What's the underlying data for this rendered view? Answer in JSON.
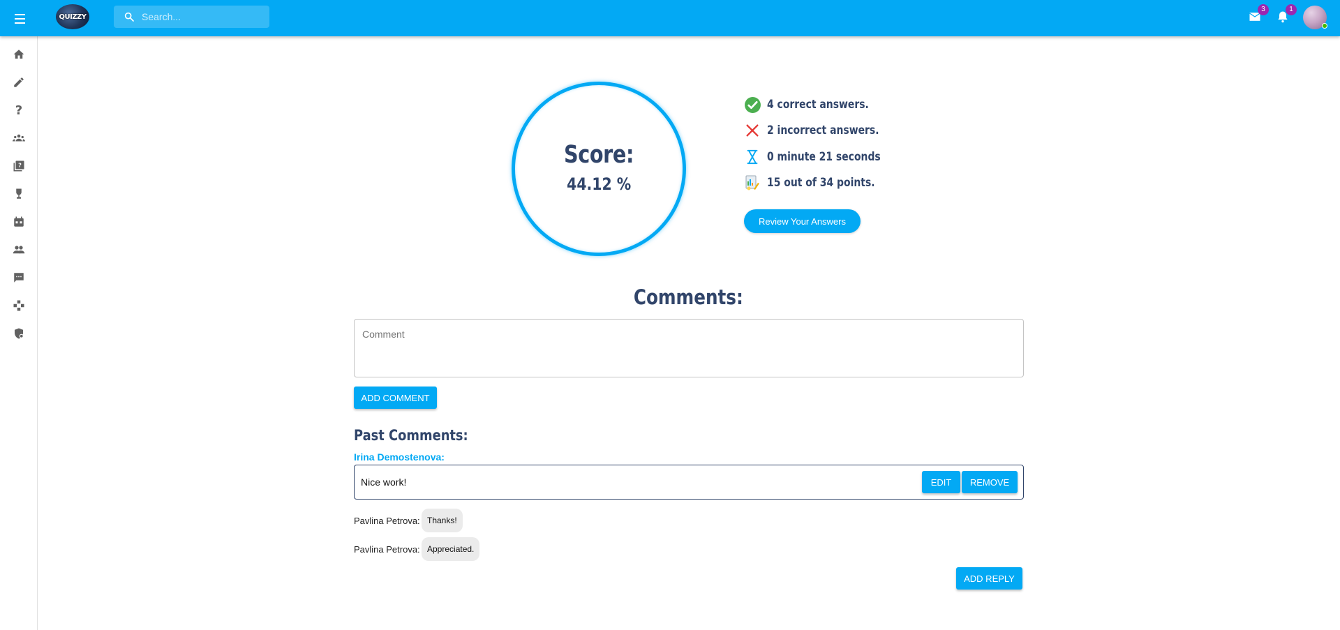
{
  "header": {
    "logo_text": "QUIZZY",
    "search_placeholder": "Search...",
    "messages_count": "3",
    "notifications_count": "1"
  },
  "sidebar": {
    "items": [
      {
        "icon": "home-icon"
      },
      {
        "icon": "pencil-icon"
      },
      {
        "icon": "question-icon"
      },
      {
        "icon": "groups-icon"
      },
      {
        "icon": "quiz-library-icon"
      },
      {
        "icon": "trophy-icon"
      },
      {
        "icon": "event-icon"
      },
      {
        "icon": "people-icon"
      },
      {
        "icon": "chat-icon"
      },
      {
        "icon": "game-icon"
      },
      {
        "icon": "admin-shield-icon"
      }
    ]
  },
  "score": {
    "title": "Score:",
    "value": "44.12 %"
  },
  "stats": {
    "correct": "4 correct answers.",
    "incorrect": "2 incorrect answers.",
    "time": "0 minute 21 seconds",
    "points": "15 out of 34 points."
  },
  "review_button": "Review Your Answers",
  "comments": {
    "title": "Comments:",
    "placeholder": "Comment",
    "add_button": "ADD COMMENT",
    "past_title": "Past Comments:",
    "main": {
      "author": "Irina Demostenova:",
      "text": "Nice work!",
      "edit_label": "EDIT",
      "remove_label": "REMOVE"
    },
    "replies": [
      {
        "author": "Pavlina Petrova:",
        "text": "Thanks!"
      },
      {
        "author": "Pavlina Petrova:",
        "text": "Appreciated."
      }
    ],
    "add_reply_button": "ADD REPLY"
  },
  "colors": {
    "primary": "#03a9f4",
    "heading": "#31456a",
    "badge": "#9c27b0",
    "correct": "#4caf50",
    "incorrect": "#e53935"
  }
}
